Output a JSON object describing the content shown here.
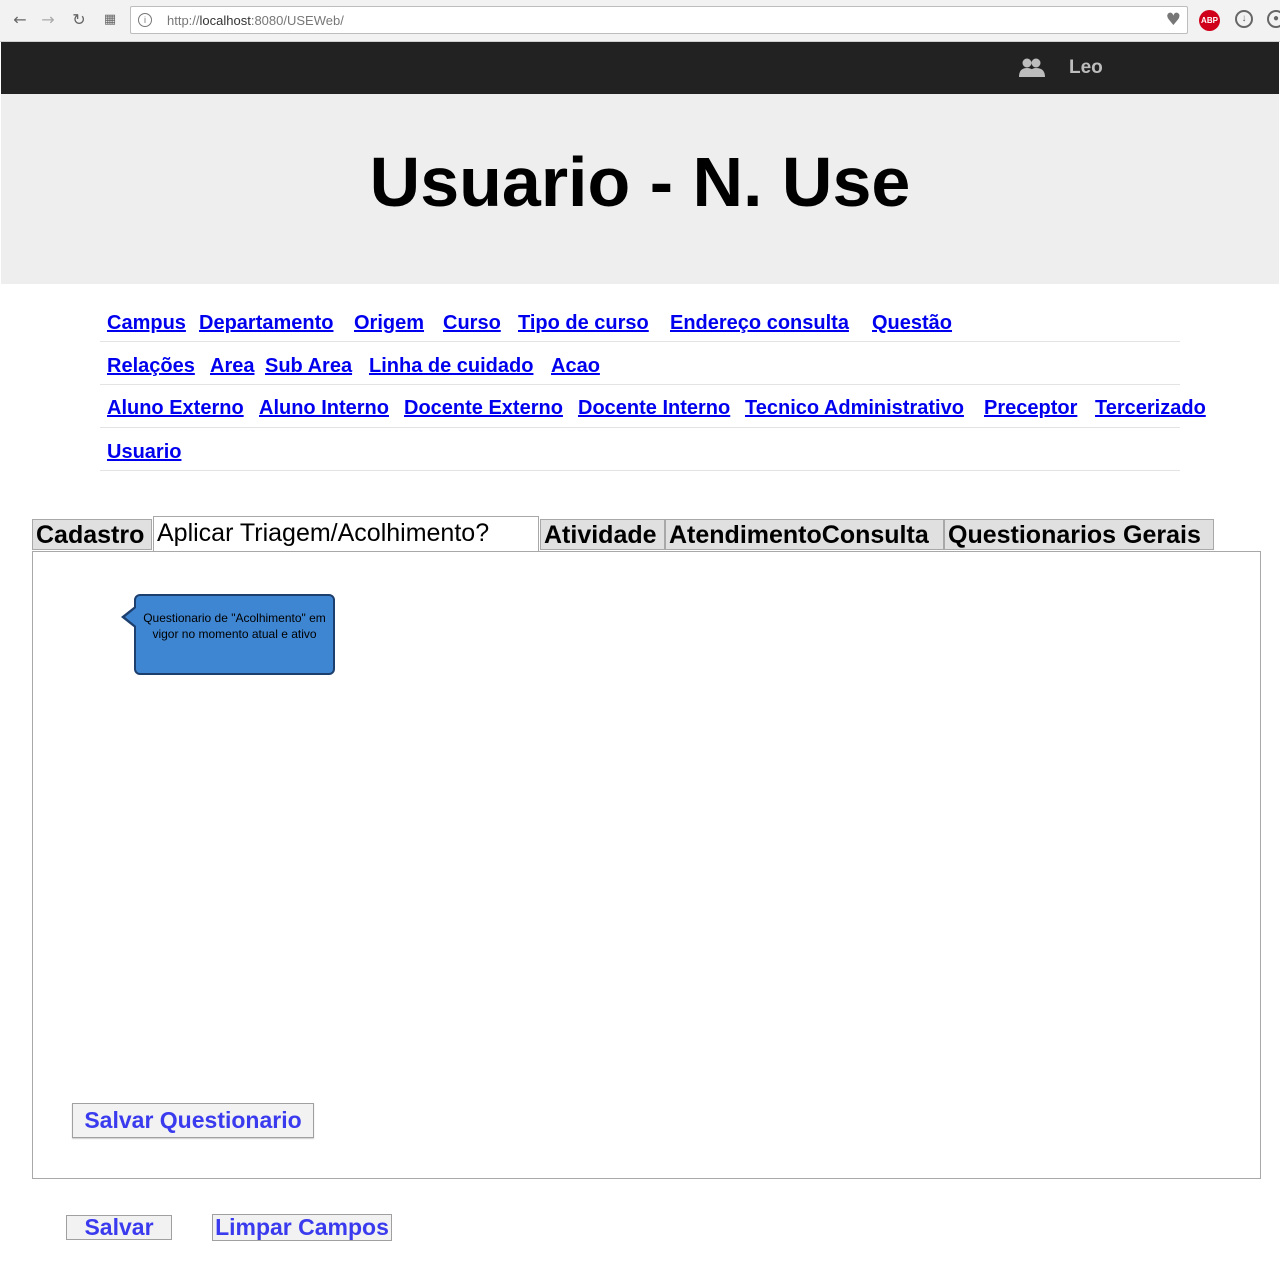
{
  "browser": {
    "url_prefix": "http://",
    "url_host": "localhost",
    "url_rest": ":8080/USEWeb/",
    "abp_label": "ABP"
  },
  "header": {
    "user_name": "Leo",
    "title": "Usuario - N. Use"
  },
  "nav": {
    "row1": [
      "Campus",
      "Departamento",
      "Origem",
      "Curso",
      "Tipo de curso",
      "Endereço consulta",
      "Questão"
    ],
    "row2": [
      "Relações",
      "Area",
      "Sub Area",
      "Linha de cuidado",
      "Acao"
    ],
    "row3": [
      "Aluno Externo",
      "Aluno Interno",
      "Docente Externo",
      "Docente Interno",
      "Tecnico Administrativo",
      "Preceptor",
      "Tercerizado"
    ],
    "row4": [
      "Usuario"
    ]
  },
  "tabs": [
    "Cadastro",
    "Aplicar Triagem/Acolhimento?",
    "Atividade",
    "AtendimentoConsulta",
    "Questionarios Gerais"
  ],
  "panel": {
    "tooltip": "Questionario de \"Acolhimento\" em vigor no momento atual e ativo",
    "save_questionnaire": "Salvar Questionario"
  },
  "actions": {
    "save": "Salvar",
    "clear": "Limpar Campos"
  },
  "colors": {
    "link": "#0000ee",
    "button_text": "#3a3aee",
    "tooltip_bg": "#3f86d2",
    "topbar_bg": "#222222"
  }
}
